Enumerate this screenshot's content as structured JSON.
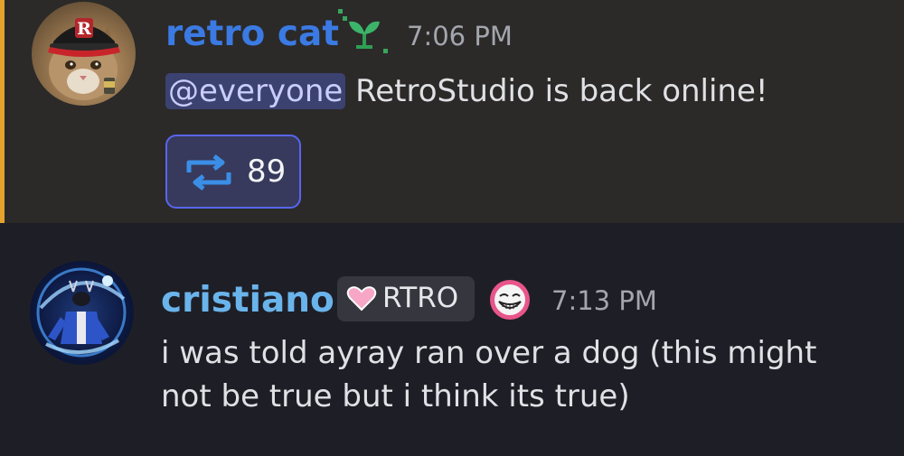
{
  "messages": [
    {
      "username": "retro cat",
      "timestamp": "7:06 PM",
      "mention": "@everyone",
      "text": " RetroStudio is back online!",
      "username_color": "#3b7ae3",
      "highlight_bar_color": "#e5a32d",
      "avatar_icon": "cat-avatar",
      "badge_icon": "sprout-icon",
      "reaction": {
        "icon": "repost-icon",
        "count": "89"
      }
    },
    {
      "username": "cristiano",
      "timestamp": "7:13 PM",
      "text_lines": [
        "i was told ayray ran over a dog (this might",
        "not be true but i think its true)"
      ],
      "username_color": "#6ab4ec",
      "avatar_icon": "character-avatar",
      "tag": {
        "icon": "heart-icon",
        "label": "RTRO"
      },
      "badge_icon": "troll-face-icon"
    }
  ],
  "colors": {
    "accent": "#5865f2",
    "mention_bg": "#3c4270",
    "background": "#1e1f26"
  }
}
